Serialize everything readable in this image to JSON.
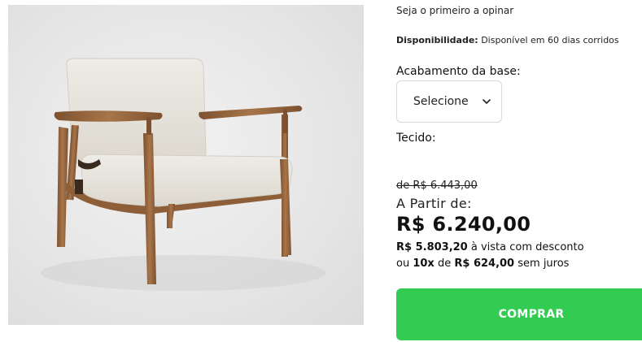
{
  "product": {
    "image_alt": "armchair-photo",
    "review_link": "Seja o primeiro a opinar",
    "availability_label": "Disponibilidade:",
    "availability_value": "Disponível em 60 dias corridos",
    "finish_label": "Acabamento da base:",
    "finish_select": {
      "selected": "Selecione",
      "options": [
        "Selecione"
      ]
    },
    "fabric_label": "Tecido:",
    "old_price": "de R$ 6.443,00",
    "from_label": "A Partir de:",
    "price": "R$ 6.240,00",
    "cash_price": "R$ 5.803,20",
    "cash_suffix": "à vista com desconto",
    "installments_prefix": "ou",
    "installments_count": "10x",
    "installments_mid": "de",
    "installment_value": "R$ 624,00",
    "installments_suffix": "sem juros",
    "buy_label": "COMPRAR"
  },
  "colors": {
    "buy_button": "#33cc52",
    "wood": "#9a6a41",
    "fabric": "#e7e4dc"
  }
}
